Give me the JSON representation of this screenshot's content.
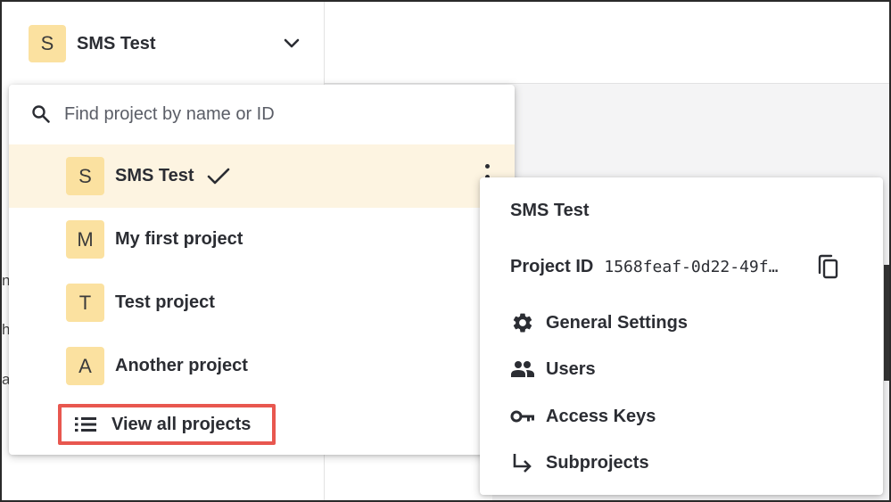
{
  "header": {
    "current_project": {
      "initial": "S",
      "name": "SMS Test"
    }
  },
  "background": {
    "side_letters": [
      "n",
      "h",
      "a"
    ]
  },
  "dropdown": {
    "search": {
      "placeholder": "Find project by name or ID",
      "value": ""
    },
    "projects": [
      {
        "initial": "S",
        "name": "SMS Test",
        "selected": true
      },
      {
        "initial": "M",
        "name": "My first project",
        "selected": false
      },
      {
        "initial": "T",
        "name": "Test project",
        "selected": false
      },
      {
        "initial": "A",
        "name": "Another project",
        "selected": false
      }
    ],
    "view_all_label": "View all projects"
  },
  "context_menu": {
    "title": "SMS Test",
    "project_id_label": "Project ID",
    "project_id_value": "1568feaf-0d22-49f…",
    "items": [
      {
        "label": "General Settings",
        "icon": "gear-icon"
      },
      {
        "label": "Users",
        "icon": "users-icon"
      },
      {
        "label": "Access Keys",
        "icon": "key-icon"
      },
      {
        "label": "Subprojects",
        "icon": "subdirectory-arrow-icon"
      }
    ]
  },
  "colors": {
    "avatar_bg": "#fbe1a0",
    "selected_row_bg": "#fdf4e1",
    "highlight_border": "#e8574f",
    "text": "#2b2d33"
  }
}
